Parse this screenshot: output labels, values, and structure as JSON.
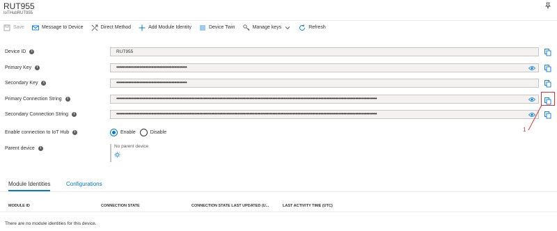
{
  "header": {
    "title": "RUT955",
    "subtitle": "IoTHubRUT955"
  },
  "toolbar": {
    "save": "Save",
    "message": "Message to Device",
    "direct": "Direct Method",
    "add_module": "Add Module Identity",
    "twin": "Device Twin",
    "keys": "Manage keys",
    "refresh": "Refresh"
  },
  "fields": {
    "device_id": {
      "label": "Device ID",
      "value": "RUT955"
    },
    "primary_key": {
      "label": "Primary Key",
      "value": "••••••••••••••••••••••••••••••••••••••••••••••"
    },
    "secondary_key": {
      "label": "Secondary Key",
      "value": "••••••••••••••••••••••••••••••••••••••••••••••"
    },
    "primary_conn": {
      "label": "Primary Connection String",
      "value": "••••••••••••••••••••••••••••••••••••••••••••••••••••••••••••••••••••••••••••••••••••••••••••••••••••••••••••••••••••••••••••••••••••••••••••••••••••••••••••••••••••••••••"
    },
    "secondary_conn": {
      "label": "Secondary Connection String",
      "value": "••••••••••••••••••••••••••••••••••••••••••••••••••••••••••••••••••••••••••••••••••••••••••••••••••••••••••••••••••••••••••••••••••••••••••••••••••••••••••••••••••••••••••"
    },
    "enable": {
      "label": "Enable connection to IoT Hub",
      "enable": "Enable",
      "disable": "Disable"
    },
    "parent": {
      "label": "Parent device",
      "value": "No parent device"
    }
  },
  "annotation": {
    "number": "1",
    "color": "#e03030"
  },
  "tabs": {
    "modules": "Module Identities",
    "configs": "Configurations"
  },
  "table": {
    "columns": [
      "MODULE ID",
      "CONNECTION STATE",
      "CONNECTION STATE LAST UPDATED (U...",
      "LAST ACTIVITY TIME (UTC)"
    ],
    "empty": "There are no module identities for this device."
  },
  "colors": {
    "accent": "#0078d4",
    "text": "#323130",
    "muted": "#605e5c"
  }
}
